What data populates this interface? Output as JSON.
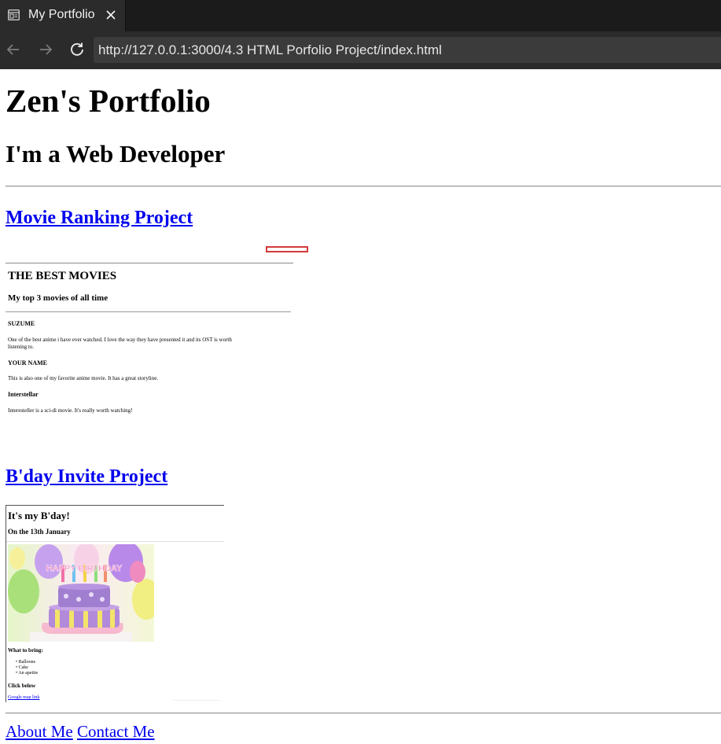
{
  "browser": {
    "tab_title": "My Portfolio",
    "url": "http://127.0.0.1:3000/4.3 HTML Porfolio Project/index.html",
    "icons": [
      "page-icon",
      "close-icon",
      "back-arrow-icon",
      "forward-arrow-icon",
      "reload-icon"
    ]
  },
  "page": {
    "title": "Zen's Portfolio",
    "subtitle": "I'm a Web Developer",
    "projects": [
      {
        "link": "Movie Ranking Project"
      },
      {
        "link": "B'day Invite Project"
      }
    ]
  },
  "movie_frame": {
    "heading": "THE BEST MOVIES",
    "subheading": "My top 3 movies of all time",
    "movies": [
      {
        "title": "SUZUME",
        "desc_line1": "One of the best anime i have ever watched. I love the way they have presented it and its OST is worth",
        "desc_line2": "listening to."
      },
      {
        "title": "YOUR NAME",
        "desc_line1": "This is also one of my favorite anime movie. It has a great storyline."
      },
      {
        "title": "Interstellar",
        "desc_line1": "Interesteller is a sci-di movie. It's really worth watching!"
      }
    ]
  },
  "bday_frame": {
    "heading": "It's my B'day!",
    "date": "On the 13th January",
    "cake_text": "HAPPY BIRTHDAY",
    "bring_heading": "What to bring:",
    "items": [
      "Balloons",
      "Cake",
      "An apetite"
    ],
    "click_heading": "Click below",
    "map_link": "Google map link"
  },
  "footer": {
    "about": "About Me",
    "contact": "Contact Me"
  },
  "colors": {
    "link": "#0000ee",
    "chrome_dark": "#1b1b1b",
    "chrome": "#2b2b2b",
    "urlbar": "#3b3b3b"
  }
}
